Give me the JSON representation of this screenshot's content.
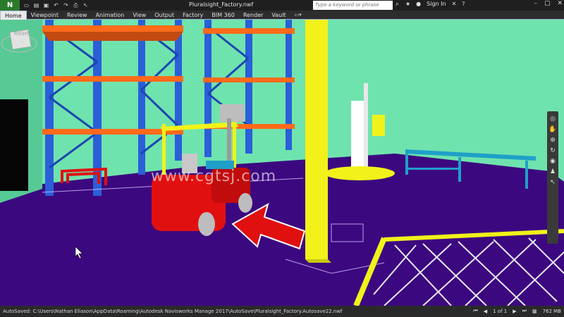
{
  "app": {
    "logo": "N",
    "doc_title": "Pluralsight_Factory.nwf"
  },
  "search": {
    "placeholder": "Type a keyword or phrase"
  },
  "signin": "Sign In",
  "tabs": [
    {
      "label": "Home",
      "active": true
    },
    {
      "label": "Viewpoint"
    },
    {
      "label": "Review"
    },
    {
      "label": "Animation"
    },
    {
      "label": "View"
    },
    {
      "label": "Output"
    },
    {
      "label": "Factory"
    },
    {
      "label": "BIM 360"
    },
    {
      "label": "Render"
    },
    {
      "label": "Vault"
    }
  ],
  "viewcube": {
    "label": "RIGHT"
  },
  "watermark": "www.cgtsj.com",
  "status": {
    "autosave": "AutoSaved: C:\\Users\\Nathan Eliason\\AppData\\Roaming\\Autodesk Navisworks Manage 2017\\AutoSave\\Pluralsight_Factory.Autosave22.nwf",
    "page": "1 of 1",
    "memory": "762 MB"
  },
  "colors": {
    "wall": "#6fe3ae",
    "floor": "#3c0880",
    "rack_upright": "#2a5fd8",
    "rack_beam": "#ff6a1a",
    "column": "#f2f21a",
    "forklift": "#e11010",
    "arrow": "#e01010"
  },
  "icons": {
    "qat": [
      "new-icon",
      "open-icon",
      "save-icon",
      "undo-icon",
      "redo-icon",
      "print-icon",
      "select-icon"
    ],
    "nav": [
      "steering-wheel-icon",
      "pan-icon",
      "zoom-icon",
      "orbit-icon",
      "look-icon",
      "walk-icon",
      "select-icon"
    ]
  }
}
